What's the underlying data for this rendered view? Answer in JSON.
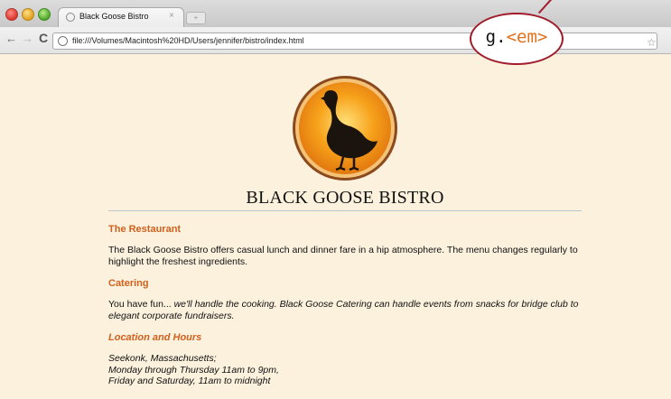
{
  "browser": {
    "tab_title": "Black Goose Bistro",
    "tab_close": "×",
    "url": "file:///Volumes/Macintosh%20HD/Users/jennifer/bistro/index.html",
    "back": "←",
    "forward": "→",
    "reload": "C",
    "star": "☆",
    "wrench": "≡"
  },
  "callout": {
    "prefix": "g.",
    "tag": "<em>"
  },
  "page": {
    "site_title": "BLACK GOOSE BISTRO",
    "sections": {
      "restaurant": {
        "heading": "The Restaurant",
        "body": "The Black Goose Bistro offers casual lunch and dinner fare in a hip atmosphere. The menu changes regularly to highlight the freshest ingredients."
      },
      "catering": {
        "heading": "Catering",
        "lead": "You have fun... ",
        "emphasis": "we'll handle the cooking. Black Goose Catering can handle events from snacks for bridge club to elegant corporate fundraisers."
      },
      "location": {
        "heading": "Location and Hours",
        "lines": [
          "Seekonk, Massachusetts;",
          "Monday through Thursday 11am to 9pm,",
          "Friday and Saturday, 11am to midnight"
        ]
      }
    }
  },
  "colors": {
    "page_bg": "#fcf1dd",
    "heading": "#d1601d",
    "callout_border": "#a11b2b",
    "callout_tag": "#e0701c"
  },
  "icons": {
    "logo": "goose-logo",
    "tab_favicon": "globe-icon",
    "url_icon": "page-icon"
  }
}
